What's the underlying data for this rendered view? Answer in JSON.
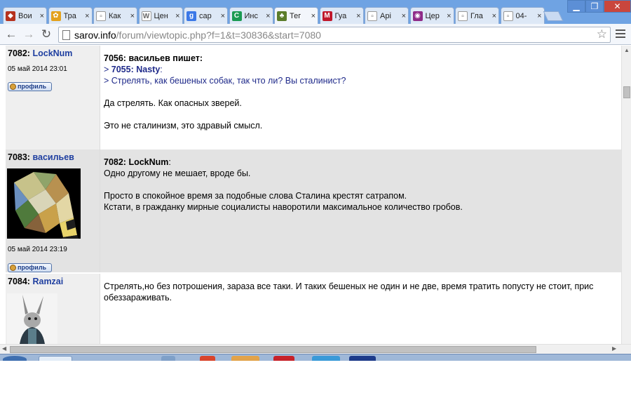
{
  "browser": {
    "tabs": [
      {
        "label": "Вои",
        "color": "#b6321e",
        "glyph": "◆"
      },
      {
        "label": "Тра",
        "color": "#e3a11d",
        "glyph": "✿"
      },
      {
        "label": "Как",
        "color": "#ffffff",
        "glyph": "▫"
      },
      {
        "label": "Цен",
        "color": "#ffffff",
        "glyph": "W"
      },
      {
        "label": "сар",
        "color": "#3b78e7",
        "glyph": "g"
      },
      {
        "label": "Инс",
        "color": "#1b9a52",
        "glyph": "C"
      },
      {
        "label": "Тег",
        "color": "#5b7d2b",
        "glyph": "♣",
        "active": true
      },
      {
        "label": "Гуа",
        "color": "#c0182b",
        "glyph": "M"
      },
      {
        "label": "Арі",
        "color": "#ffffff",
        "glyph": "▫"
      },
      {
        "label": "Цер",
        "color": "#8e2a88",
        "glyph": "◉"
      },
      {
        "label": "Гла",
        "color": "#ffffff",
        "glyph": "▫"
      },
      {
        "label": "04-",
        "color": "#ffffff",
        "glyph": "▫"
      }
    ],
    "close_glyph": "×",
    "url_host": "sarov.info",
    "url_path": "/forum/viewtopic.php?f=1&t=30836&start=7080"
  },
  "posts": [
    {
      "number": "7082:",
      "author": "LockNum",
      "date": "05 май 2014 23:01",
      "profile_label": "профиль",
      "quote_header": "7056: васильев пишет:",
      "quote_ref_prefix": "> ",
      "quote_ref_num": "7055: Nasty",
      "quote_ref_suffix": ":",
      "quote_text": "> Стрелять, как бешеных собак, так что ли? Вы сталинист?",
      "lines": [
        "Да стрелять. Как опасных зверей.",
        "Это не сталинизм, это здравый смысл."
      ]
    },
    {
      "number": "7083:",
      "author": "васильев",
      "date": "05 май 2014 23:19",
      "profile_label": "профиль",
      "reply_to": "7082: LockNum",
      "reply_suffix": ":",
      "lines": [
        "Одно другому не мешает, вроде бы.",
        "Просто в спокойное время за подобные слова Сталина крестят сатрапом.",
        "Кстати, в гражданку мирные социалисты наворотили максимальное количество гробов."
      ]
    },
    {
      "number": "7084:",
      "author": "Ramzai",
      "lines": [
        "Стрелять,но без потрошения, зараза все таки. И таких бешеных не один и не две, время тратить попусту не стоит, прис",
        "обеззараживать."
      ]
    }
  ]
}
